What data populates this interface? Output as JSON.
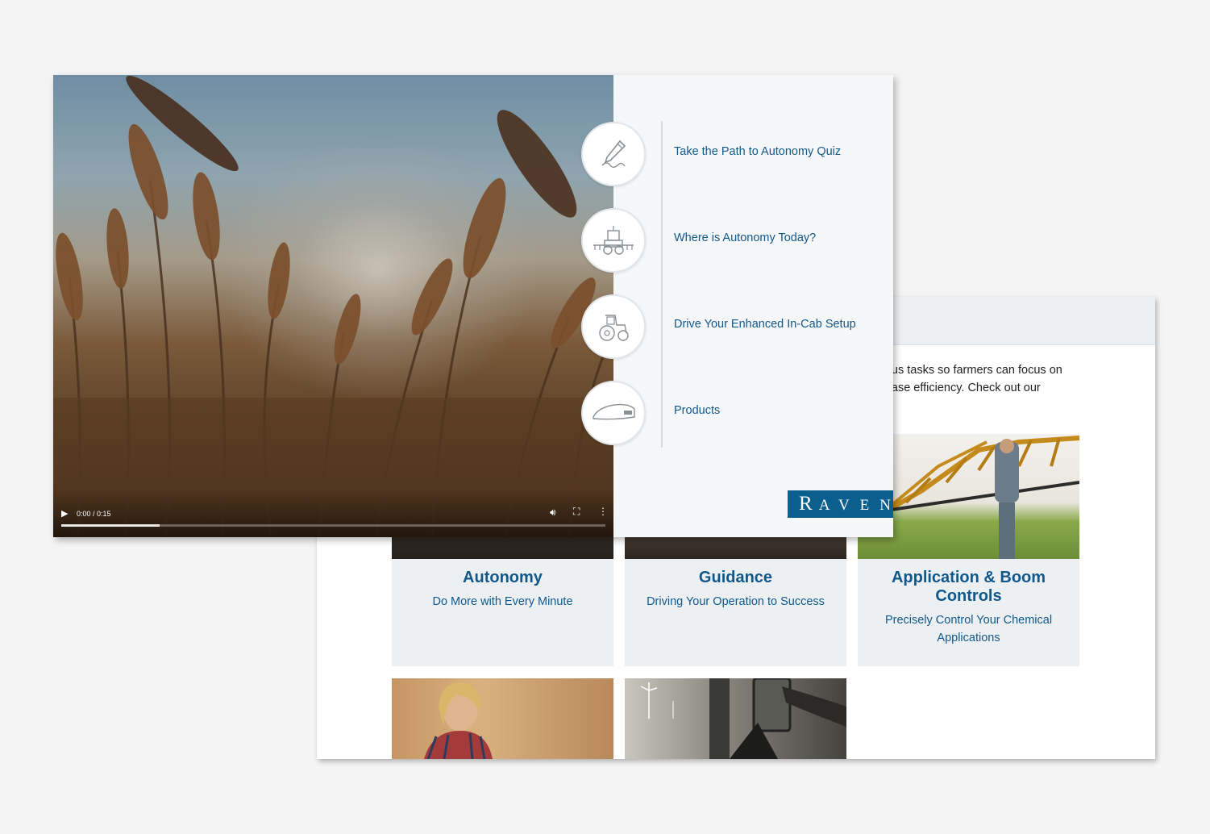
{
  "back_page": {
    "intro_text": "rous tasks so farmers can focus on\nrease efficiency. Check out our",
    "tiles": [
      {
        "title": "Autonomy",
        "subtitle": "Do More with Every Minute"
      },
      {
        "title": "Guidance",
        "subtitle": "Driving Your Operation to Success"
      },
      {
        "title": "Application & Boom Controls",
        "subtitle": "Precisely Control Your Chemical Applications"
      },
      {
        "title": "",
        "subtitle": ""
      },
      {
        "title": "",
        "subtitle": ""
      }
    ]
  },
  "video": {
    "time": "0:00 / 0:15",
    "progress_fraction": 0.18,
    "controls": [
      "play-icon",
      "volume-icon",
      "fullscreen-icon",
      "more-options-icon"
    ]
  },
  "menu": {
    "items": [
      {
        "label": "Take the Path to Autonomy Quiz",
        "icon": "pen-signature-icon"
      },
      {
        "label": "Where is Autonomy Today?",
        "icon": "autonomous-sprayer-icon"
      },
      {
        "label": "Drive Your Enhanced In-Cab Setup",
        "icon": "tractor-icon"
      },
      {
        "label": "Products",
        "icon": "guidance-display-icon"
      }
    ]
  },
  "brand": {
    "logo_text": "RAVEN",
    "accent_color": "#11588a",
    "logo_bg": "#0b5f8f"
  }
}
